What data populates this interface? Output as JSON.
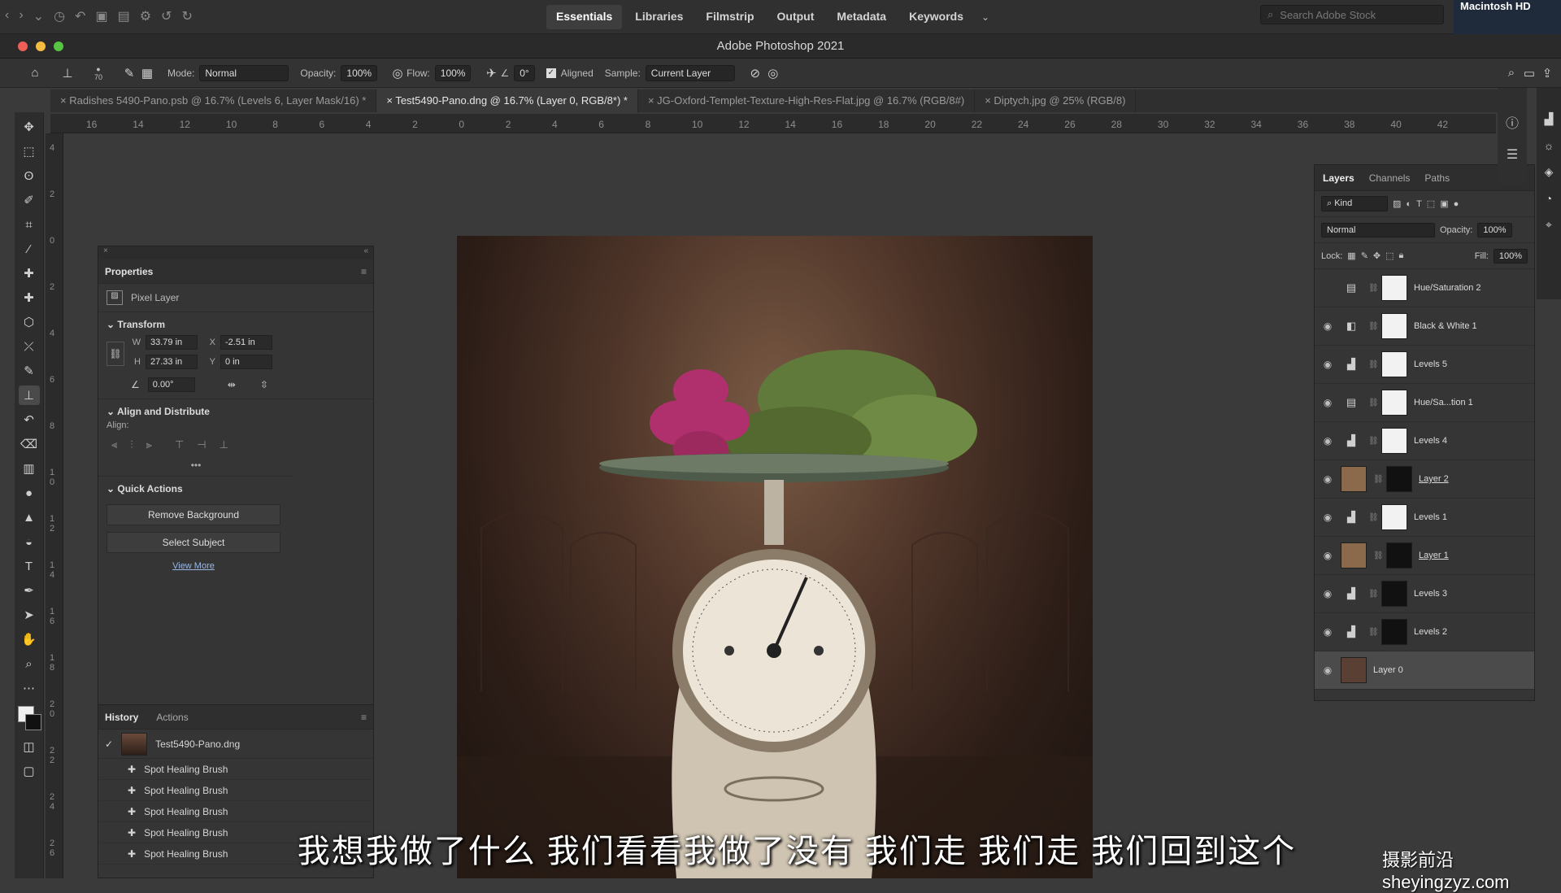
{
  "bridge": {
    "workspace_tabs": [
      "Essentials",
      "Libraries",
      "Filmstrip",
      "Output",
      "Metadata",
      "Keywords"
    ],
    "search_placeholder": "Search Adobe Stock",
    "volume_label": "Macintosh HD"
  },
  "window": {
    "title": "Adobe Photoshop 2021"
  },
  "options_bar": {
    "brush_size": "70",
    "mode_label": "Mode:",
    "mode_value": "Normal",
    "opacity_label": "Opacity:",
    "opacity_value": "100%",
    "flow_label": "Flow:",
    "flow_value": "100%",
    "angle_value": "0°",
    "aligned_label": "Aligned",
    "sample_label": "Sample:",
    "sample_value": "Current Layer"
  },
  "doc_tabs": [
    "Radishes 5490-Pano.psb @ 16.7% (Levels 6, Layer Mask/16) *",
    "Test5490-Pano.dng @ 16.7% (Layer 0, RGB/8*) *",
    "JG-Oxford-Templet-Texture-High-Res-Flat.jpg @ 16.7% (RGB/8#)",
    "Diptych.jpg @ 25% (RGB/8)"
  ],
  "ruler": {
    "h_ticks": [
      "16",
      "14",
      "12",
      "10",
      "8",
      "6",
      "4",
      "2",
      "0",
      "2",
      "4",
      "6",
      "8",
      "10",
      "12",
      "14",
      "16",
      "18",
      "20",
      "22",
      "24",
      "26",
      "28",
      "30",
      "32",
      "34",
      "36",
      "38",
      "40",
      "42"
    ],
    "v_ticks": [
      "4",
      "2",
      "0",
      "2",
      "4",
      "6",
      "8",
      "1 0",
      "1 2",
      "1 4",
      "1 6",
      "1 8",
      "2 0",
      "2 2",
      "2 4",
      "2 6"
    ]
  },
  "properties": {
    "title": "Properties",
    "layer_type": "Pixel Layer",
    "transform_title": "Transform",
    "w_label": "W",
    "w_value": "33.79 in",
    "x_label": "X",
    "x_value": "-2.51 in",
    "h_label": "H",
    "h_value": "27.33 in",
    "y_label": "Y",
    "y_value": "0 in",
    "angle_value": "0.00°",
    "align_title": "Align and Distribute",
    "align_label": "Align:",
    "quick_actions_title": "Quick Actions",
    "remove_bg": "Remove Background",
    "select_subject": "Select Subject",
    "view_more": "View More"
  },
  "history": {
    "tabs": [
      "History",
      "Actions"
    ],
    "snapshot": "Test5490-Pano.dng",
    "steps": [
      "Spot Healing Brush",
      "Spot Healing Brush",
      "Spot Healing Brush",
      "Spot Healing Brush",
      "Spot Healing Brush"
    ]
  },
  "layers_panel": {
    "tabs": [
      "Layers",
      "Channels",
      "Paths"
    ],
    "kind_label": "Kind",
    "blend_mode": "Normal",
    "opacity_label": "Opacity:",
    "opacity_value": "100%",
    "lock_label": "Lock:",
    "fill_label": "Fill:",
    "fill_value": "100%",
    "layers": [
      {
        "name": "Hue/Saturation 2",
        "icon": "hue-sat"
      },
      {
        "name": "Black & White 1",
        "icon": "bw"
      },
      {
        "name": "Levels 5",
        "icon": "levels"
      },
      {
        "name": "Hue/Sa...tion 1",
        "icon": "hue-sat"
      },
      {
        "name": "Levels 4",
        "icon": "levels"
      },
      {
        "name": "Layer 2",
        "icon": "pixel"
      },
      {
        "name": "Levels 1",
        "icon": "levels"
      },
      {
        "name": "Layer 1",
        "icon": "pixel"
      },
      {
        "name": "Levels 3",
        "icon": "levels"
      },
      {
        "name": "Levels 2",
        "icon": "levels"
      },
      {
        "name": "Layer 0",
        "icon": "pixel"
      }
    ]
  },
  "subtitle": "我想我做了什么  我们看看我做了没有  我们走  我们走  我们回到这个",
  "watermark": "摄影前沿 sheyingzyz.com",
  "colors": {
    "accent": "#9ab7e4",
    "panel_bg": "#353535",
    "app_bg": "#3a3a3a"
  }
}
